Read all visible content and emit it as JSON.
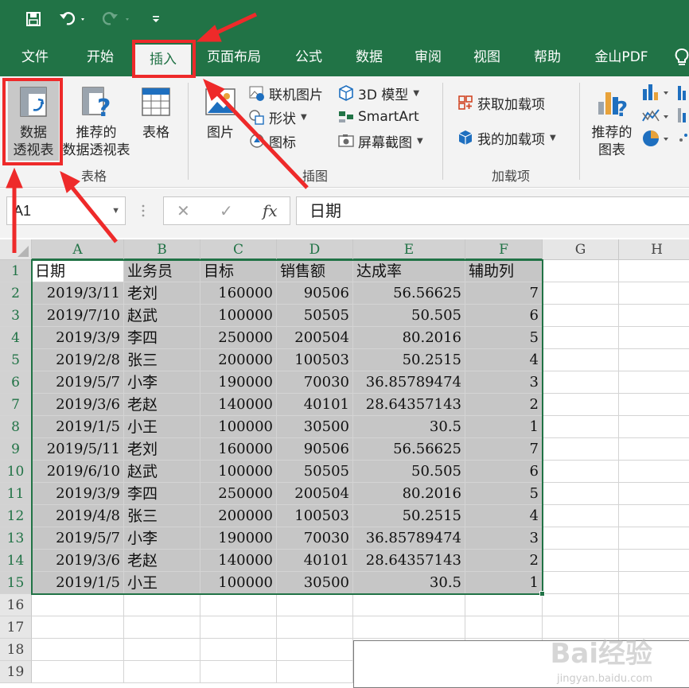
{
  "quick_access": {
    "save_icon": "save-icon",
    "undo_icon": "undo-icon",
    "redo_icon": "redo-icon",
    "customize_icon": "customize-qat-icon"
  },
  "tabs": [
    "文件",
    "开始",
    "插入",
    "页面布局",
    "公式",
    "数据",
    "审阅",
    "视图",
    "帮助",
    "金山PDF"
  ],
  "active_tab": "插入",
  "ribbon": {
    "pivot_table_label1": "数据",
    "pivot_table_label2": "透视表",
    "recommended_pivot_label1": "推荐的",
    "recommended_pivot_label2": "数据透视表",
    "table_label": "表格",
    "group_tables": "表格",
    "pictures_label": "图片",
    "online_pictures": "联机图片",
    "shapes": "形状",
    "icons": "图标",
    "model_3d": "3D 模型",
    "smartart": "SmartArt",
    "screenshot": "屏幕截图",
    "group_illustrations": "插图",
    "get_addins": "获取加载项",
    "my_addins": "我的加载项",
    "group_addins": "加载项",
    "recommended_charts_label1": "推荐的",
    "recommended_charts_label2": "图表"
  },
  "formula_bar": {
    "name_box": "A1",
    "cancel": "✕",
    "enter": "✓",
    "fx": "fx",
    "content": "日期"
  },
  "columns": [
    "A",
    "B",
    "C",
    "D",
    "E",
    "F",
    "G",
    "H"
  ],
  "rows": [
    "1",
    "2",
    "3",
    "4",
    "5",
    "6",
    "7",
    "8",
    "9",
    "10",
    "11",
    "12",
    "13",
    "14",
    "15",
    "16",
    "17",
    "18",
    "19"
  ],
  "table": {
    "headers": [
      "日期",
      "业务员",
      "目标",
      "销售额",
      "达成率",
      "辅助列"
    ],
    "rows": [
      [
        "2019/3/11",
        "老刘",
        "160000",
        "90506",
        "56.56625",
        "7"
      ],
      [
        "2019/7/10",
        "赵武",
        "100000",
        "50505",
        "50.505",
        "6"
      ],
      [
        "2019/3/9",
        "李四",
        "250000",
        "200504",
        "80.2016",
        "5"
      ],
      [
        "2019/2/8",
        "张三",
        "200000",
        "100503",
        "50.2515",
        "4"
      ],
      [
        "2019/5/7",
        "小李",
        "190000",
        "70030",
        "36.85789474",
        "3"
      ],
      [
        "2019/3/6",
        "老赵",
        "140000",
        "40101",
        "28.64357143",
        "2"
      ],
      [
        "2019/1/5",
        "小王",
        "100000",
        "30500",
        "30.5",
        "1"
      ],
      [
        "2019/5/11",
        "老刘",
        "160000",
        "90506",
        "56.56625",
        "7"
      ],
      [
        "2019/6/10",
        "赵武",
        "100000",
        "50505",
        "50.505",
        "6"
      ],
      [
        "2019/3/9",
        "李四",
        "250000",
        "200504",
        "80.2016",
        "5"
      ],
      [
        "2019/4/8",
        "张三",
        "200000",
        "100503",
        "50.2515",
        "4"
      ],
      [
        "2019/5/7",
        "小李",
        "190000",
        "70030",
        "36.85789474",
        "3"
      ],
      [
        "2019/3/6",
        "老赵",
        "140000",
        "40101",
        "28.64357143",
        "2"
      ],
      [
        "2019/1/5",
        "小王",
        "100000",
        "30500",
        "30.5",
        "1"
      ]
    ]
  },
  "watermark": {
    "brand": "Bai经验",
    "url": "jingyan.baidu.com"
  },
  "colors": {
    "excel_green": "#217346",
    "annotation_red": "#ee2a2a",
    "selection_gray": "#c6c6c6"
  }
}
